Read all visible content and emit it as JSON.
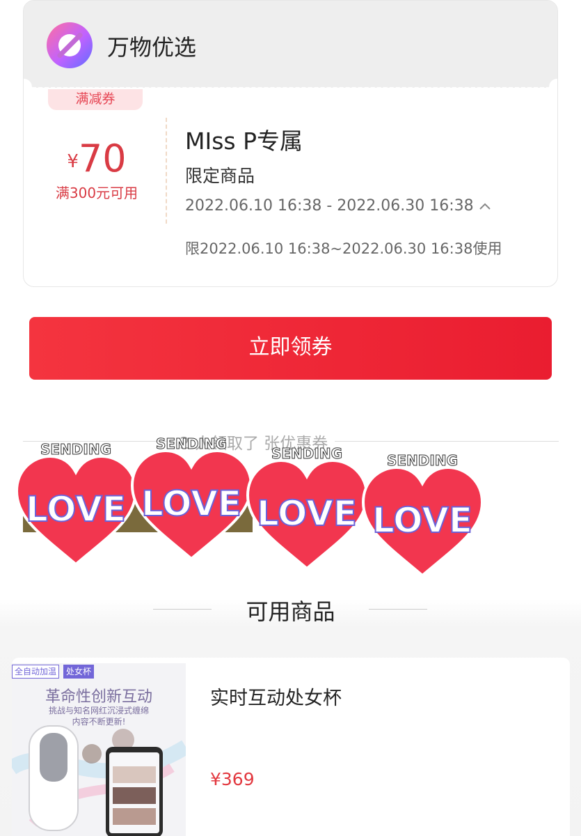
{
  "shop": {
    "name": "万物优选",
    "logo_icon": "brand-logo-icon"
  },
  "coupon": {
    "tag": "满减券",
    "currency": "¥",
    "amount": "70",
    "condition": "满300元可用",
    "title": "MIss P专属",
    "scope": "限定商品",
    "date_range": "2022.06.10 16:38 - 2022.06.30 16:38",
    "usage_limit": "限2022.06.10 16:38~2022.06.30 16:38使用",
    "expand_icon": "chevron-up-icon"
  },
  "claim_button": {
    "label": "立即领券"
  },
  "stats": {
    "text": "2 人领取了 张优惠券"
  },
  "stickers": [
    {
      "top": "SENDING",
      "main": "LOVE"
    },
    {
      "top": "SENDING",
      "main": "LOVE"
    },
    {
      "top": "SENDING",
      "main": "LOVE"
    },
    {
      "top": "SENDING",
      "main": "LOVE"
    }
  ],
  "goods_section": {
    "title": "可用商品"
  },
  "product": {
    "badge_left": "全自动加温",
    "badge_right": "处女杯",
    "image_headline": "革命性创新互动",
    "image_sub_1": "挑战与知名网红沉浸式缠绵",
    "image_sub_2": "内容不断更新!",
    "name": "实时互动处女杯",
    "price": "¥369"
  },
  "colors": {
    "accent": "#e9222f",
    "price": "#e2383f",
    "heart": "#f2364f"
  }
}
